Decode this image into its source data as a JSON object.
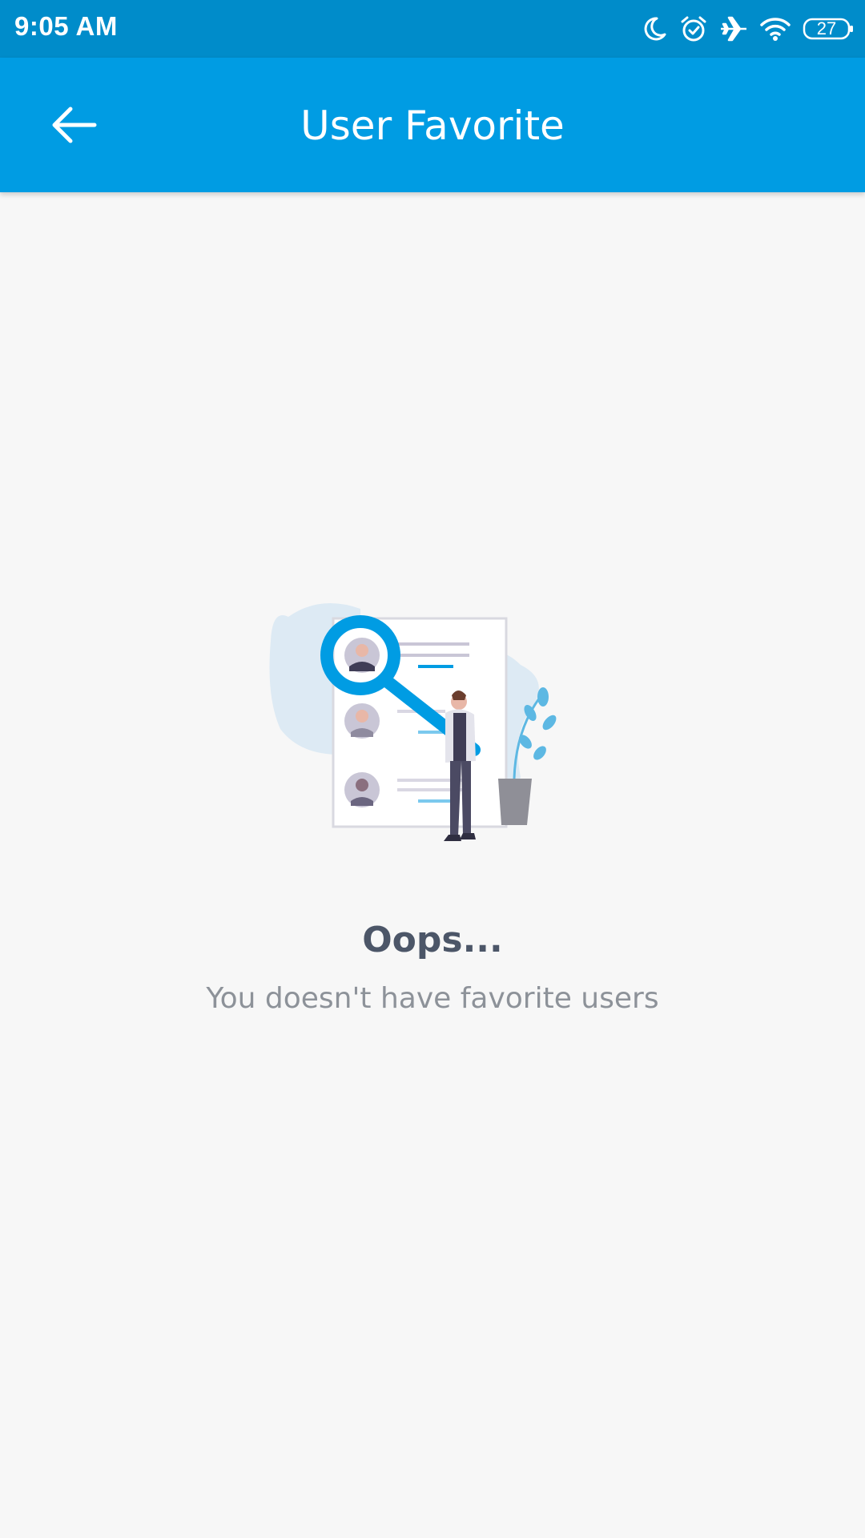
{
  "status_bar": {
    "time": "9:05 AM",
    "battery_level": "27",
    "icons": [
      "moon-icon",
      "alarm-icon",
      "airplane-icon",
      "wifi-icon",
      "battery-icon"
    ]
  },
  "app_bar": {
    "title": "User Favorite",
    "back_icon": "arrow-left-icon"
  },
  "empty_state": {
    "title": "Oops...",
    "message": "You doesn't have favorite users"
  },
  "colors": {
    "status_bar": "#008cca",
    "app_bar": "#009ce3",
    "background": "#f7f7f7",
    "title_text": "#4c5668",
    "message_text": "#8d9299",
    "accent": "#009ce3"
  }
}
